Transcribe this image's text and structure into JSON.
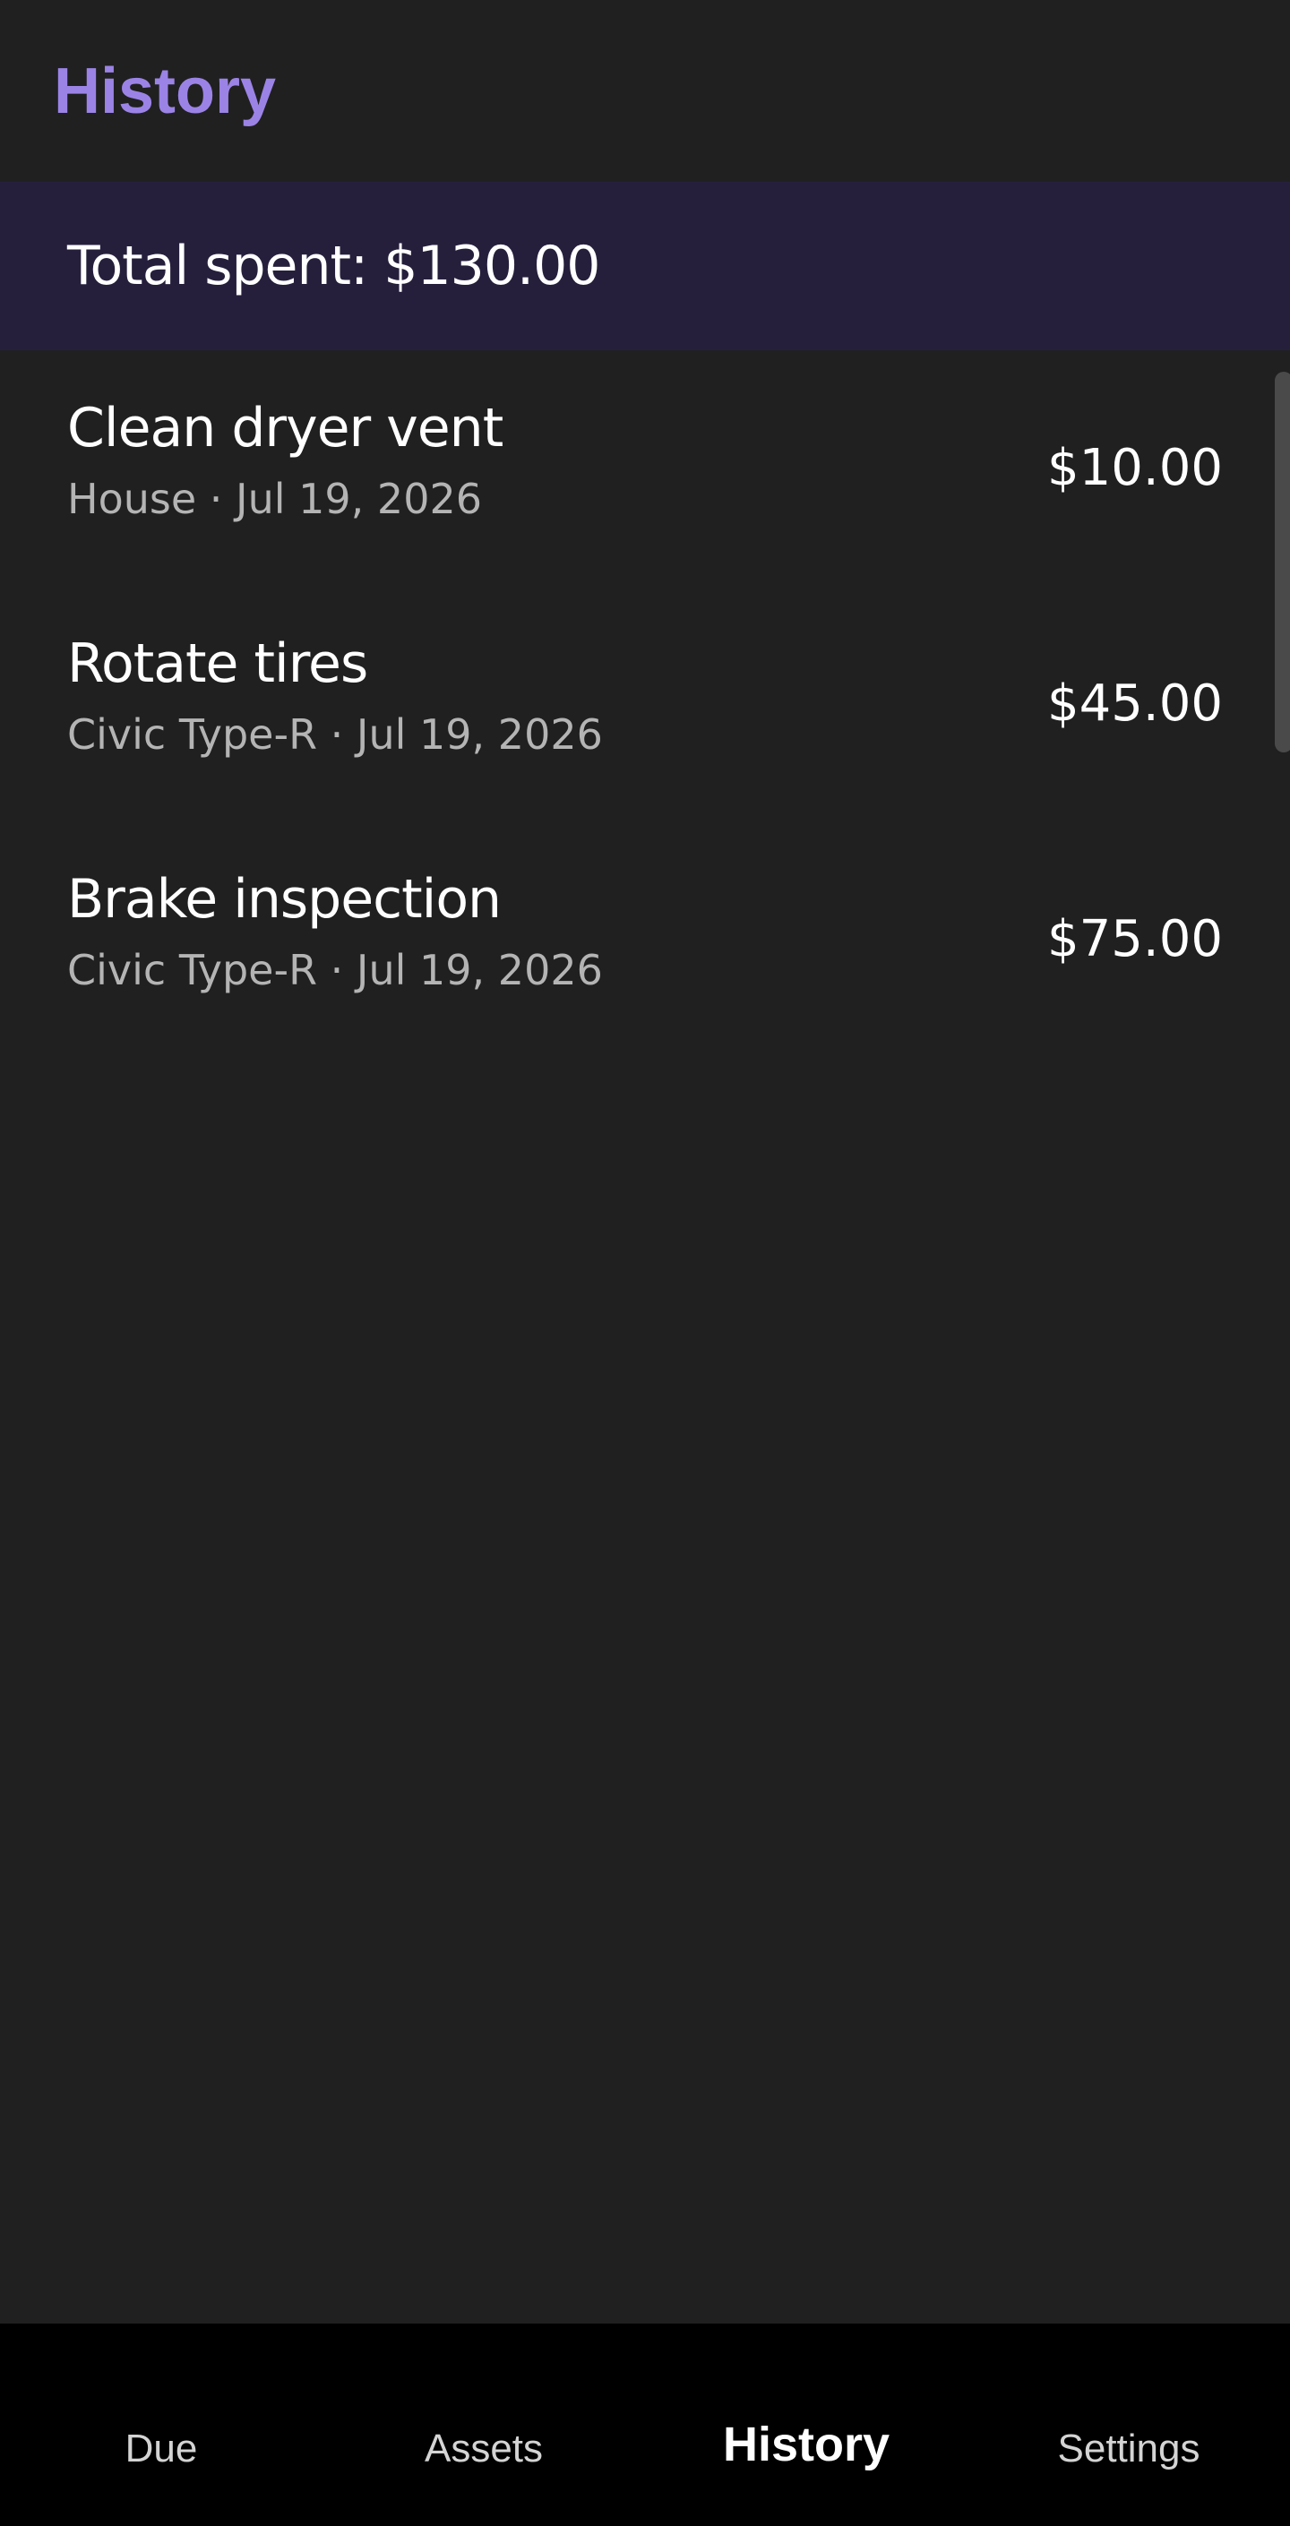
{
  "app_bar": {
    "title": "History",
    "title_color": "#9b83e6"
  },
  "summary": {
    "text": "Total spent: $130.00",
    "background": "#261f3c"
  },
  "history": {
    "items": [
      {
        "title": "Clean dryer vent",
        "subtitle": "House · Jul 19, 2026",
        "amount": "$10.00"
      },
      {
        "title": "Rotate tires",
        "subtitle": "Civic Type-R · Jul 19, 2026",
        "amount": "$45.00"
      },
      {
        "title": "Brake inspection",
        "subtitle": "Civic Type-R · Jul 19, 2026",
        "amount": "$75.00"
      }
    ]
  },
  "bottom_nav": {
    "items": [
      {
        "label": "Due",
        "active": false
      },
      {
        "label": "Assets",
        "active": false
      },
      {
        "label": "History",
        "active": true
      },
      {
        "label": "Settings",
        "active": false
      }
    ]
  }
}
